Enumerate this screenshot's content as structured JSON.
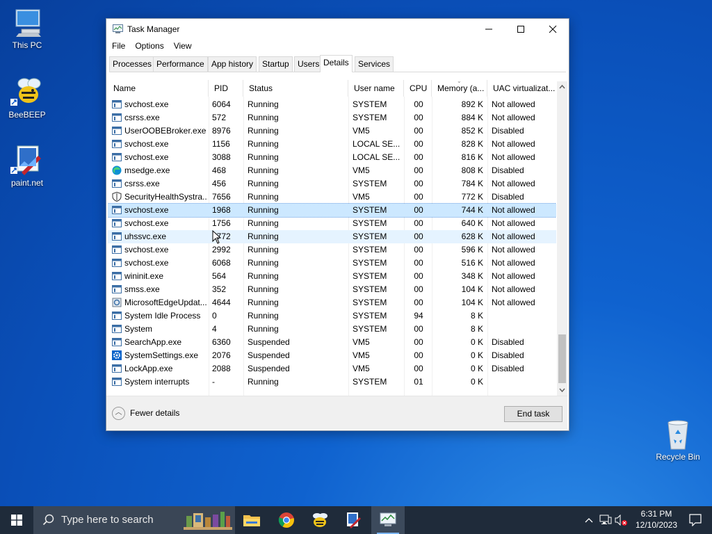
{
  "desktop": {
    "icons": [
      {
        "label": "This PC"
      },
      {
        "label": "BeeBEEP"
      },
      {
        "label": "paint.net"
      },
      {
        "label": "Recycle Bin"
      }
    ]
  },
  "window": {
    "title": "Task Manager",
    "menu": [
      "File",
      "Options",
      "View"
    ],
    "tabs": [
      "Processes",
      "Performance",
      "App history",
      "Startup",
      "Users",
      "Details",
      "Services"
    ],
    "active_tab": "Details",
    "columns": [
      "Name",
      "PID",
      "Status",
      "User name",
      "CPU",
      "Memory (a...",
      "UAC virtualizat..."
    ],
    "rows": [
      {
        "name": "svchost.exe",
        "pid": "6064",
        "status": "Running",
        "user": "SYSTEM",
        "cpu": "00",
        "mem": "892 K",
        "uac": "Not allowed",
        "icon": "service-icon"
      },
      {
        "name": "csrss.exe",
        "pid": "572",
        "status": "Running",
        "user": "SYSTEM",
        "cpu": "00",
        "mem": "884 K",
        "uac": "Not allowed",
        "icon": "service-icon"
      },
      {
        "name": "UserOOBEBroker.exe",
        "pid": "8976",
        "status": "Running",
        "user": "VM5",
        "cpu": "00",
        "mem": "852 K",
        "uac": "Disabled",
        "icon": "service-icon"
      },
      {
        "name": "svchost.exe",
        "pid": "1156",
        "status": "Running",
        "user": "LOCAL SE...",
        "cpu": "00",
        "mem": "828 K",
        "uac": "Not allowed",
        "icon": "service-icon"
      },
      {
        "name": "svchost.exe",
        "pid": "3088",
        "status": "Running",
        "user": "LOCAL SE...",
        "cpu": "00",
        "mem": "816 K",
        "uac": "Not allowed",
        "icon": "service-icon"
      },
      {
        "name": "msedge.exe",
        "pid": "468",
        "status": "Running",
        "user": "VM5",
        "cpu": "00",
        "mem": "808 K",
        "uac": "Disabled",
        "icon": "edge-icon"
      },
      {
        "name": "csrss.exe",
        "pid": "456",
        "status": "Running",
        "user": "SYSTEM",
        "cpu": "00",
        "mem": "784 K",
        "uac": "Not allowed",
        "icon": "service-icon"
      },
      {
        "name": "SecurityHealthSystra...",
        "pid": "7656",
        "status": "Running",
        "user": "VM5",
        "cpu": "00",
        "mem": "772 K",
        "uac": "Disabled",
        "icon": "shield-icon"
      },
      {
        "name": "svchost.exe",
        "pid": "1968",
        "status": "Running",
        "user": "SYSTEM",
        "cpu": "00",
        "mem": "744 K",
        "uac": "Not allowed",
        "icon": "service-icon",
        "selected": true
      },
      {
        "name": "svchost.exe",
        "pid": "1756",
        "status": "Running",
        "user": "SYSTEM",
        "cpu": "00",
        "mem": "640 K",
        "uac": "Not allowed",
        "icon": "service-icon"
      },
      {
        "name": "uhssvc.exe",
        "pid": "5772",
        "status": "Running",
        "user": "SYSTEM",
        "cpu": "00",
        "mem": "628 K",
        "uac": "Not allowed",
        "icon": "service-icon",
        "hover": true
      },
      {
        "name": "svchost.exe",
        "pid": "2992",
        "status": "Running",
        "user": "SYSTEM",
        "cpu": "00",
        "mem": "596 K",
        "uac": "Not allowed",
        "icon": "service-icon"
      },
      {
        "name": "svchost.exe",
        "pid": "6068",
        "status": "Running",
        "user": "SYSTEM",
        "cpu": "00",
        "mem": "516 K",
        "uac": "Not allowed",
        "icon": "service-icon"
      },
      {
        "name": "wininit.exe",
        "pid": "564",
        "status": "Running",
        "user": "SYSTEM",
        "cpu": "00",
        "mem": "348 K",
        "uac": "Not allowed",
        "icon": "service-icon"
      },
      {
        "name": "smss.exe",
        "pid": "352",
        "status": "Running",
        "user": "SYSTEM",
        "cpu": "00",
        "mem": "104 K",
        "uac": "Not allowed",
        "icon": "service-icon"
      },
      {
        "name": "MicrosoftEdgeUpdat...",
        "pid": "4644",
        "status": "Running",
        "user": "SYSTEM",
        "cpu": "00",
        "mem": "104 K",
        "uac": "Not allowed",
        "icon": "updater-icon"
      },
      {
        "name": "System Idle Process",
        "pid": "0",
        "status": "Running",
        "user": "SYSTEM",
        "cpu": "94",
        "mem": "8 K",
        "uac": "",
        "icon": "service-icon"
      },
      {
        "name": "System",
        "pid": "4",
        "status": "Running",
        "user": "SYSTEM",
        "cpu": "00",
        "mem": "8 K",
        "uac": "",
        "icon": "service-icon"
      },
      {
        "name": "SearchApp.exe",
        "pid": "6360",
        "status": "Suspended",
        "user": "VM5",
        "cpu": "00",
        "mem": "0 K",
        "uac": "Disabled",
        "icon": "service-icon"
      },
      {
        "name": "SystemSettings.exe",
        "pid": "2076",
        "status": "Suspended",
        "user": "VM5",
        "cpu": "00",
        "mem": "0 K",
        "uac": "Disabled",
        "icon": "settings-gear-icon"
      },
      {
        "name": "LockApp.exe",
        "pid": "2088",
        "status": "Suspended",
        "user": "VM5",
        "cpu": "00",
        "mem": "0 K",
        "uac": "Disabled",
        "icon": "service-icon"
      },
      {
        "name": "System interrupts",
        "pid": "-",
        "status": "Running",
        "user": "SYSTEM",
        "cpu": "01",
        "mem": "0 K",
        "uac": "",
        "icon": "service-icon"
      }
    ],
    "footer": {
      "fewer_details": "Fewer details",
      "end_task": "End task"
    }
  },
  "taskbar": {
    "search_placeholder": "Type here to search",
    "time": "6:31 PM",
    "date": "12/10/2023"
  },
  "colors": {
    "accent": "#0078d7",
    "selection": "#cce8ff",
    "taskbar": "#1f2b3a"
  }
}
